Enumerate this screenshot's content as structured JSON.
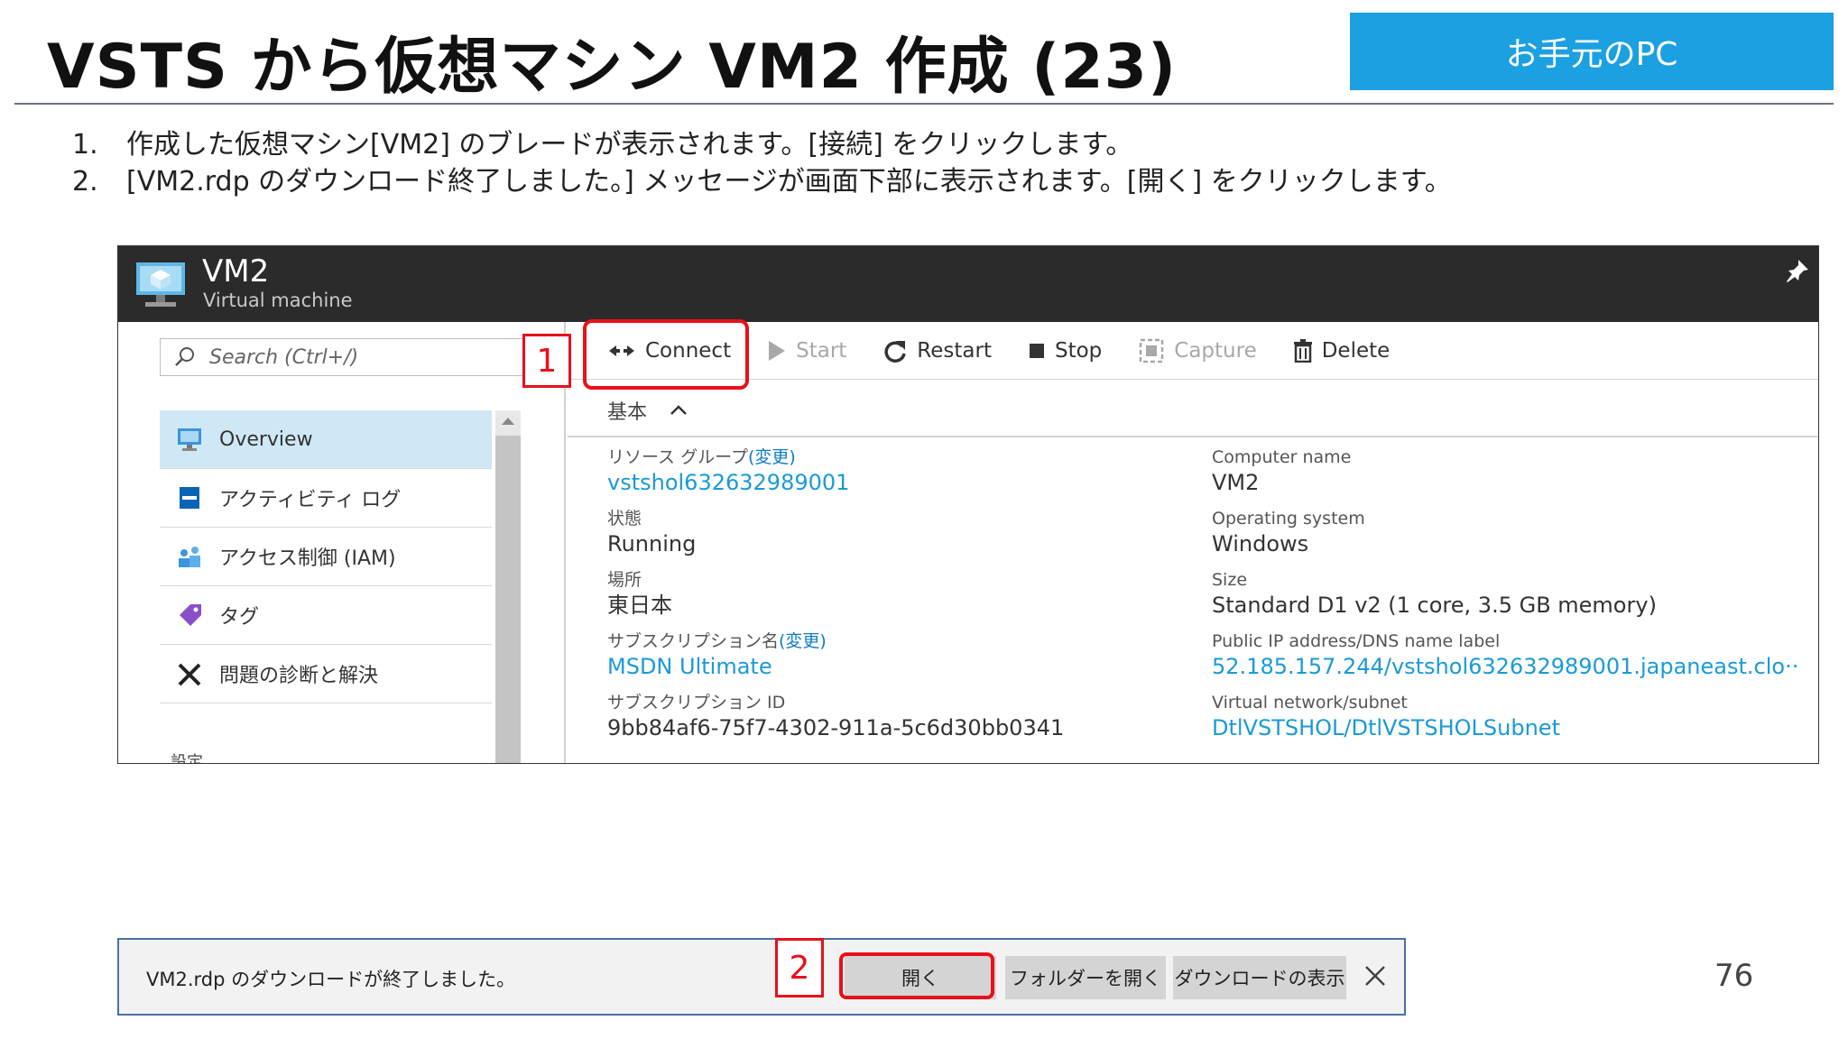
{
  "slide": {
    "title": "VSTS から仮想マシン VM2 作成 (23)",
    "badge": "お手元のPC",
    "steps": [
      {
        "num": "1.",
        "text": "作成した仮想マシン[VM2] のブレードが表示されます。[接続] をクリックします。"
      },
      {
        "num": "2.",
        "text": "[VM2.rdp のダウンロード終了しました。] メッセージが画面下部に表示されます。[開く] をクリックします。"
      }
    ],
    "page_number": "76",
    "callouts": {
      "one": "1",
      "two": "2"
    }
  },
  "blade": {
    "title": "VM2",
    "subtitle": "Virtual machine",
    "search_placeholder": "Search (Ctrl+/)",
    "nav": [
      {
        "label": "Overview",
        "icon": "monitor-icon"
      },
      {
        "label": "アクティビティ ログ",
        "icon": "activity-log-icon"
      },
      {
        "label": "アクセス制御 (IAM)",
        "icon": "users-icon"
      },
      {
        "label": "タグ",
        "icon": "tag-icon"
      },
      {
        "label": "問題の診断と解決",
        "icon": "tools-icon"
      }
    ],
    "section_label": "設定",
    "toolbar": {
      "connect": "Connect",
      "start": "Start",
      "restart": "Restart",
      "stop": "Stop",
      "capture": "Capture",
      "delete": "Delete"
    },
    "essentials": "基本",
    "properties_left": [
      {
        "label": "リソース グループ",
        "change": "(変更)",
        "value": "vstshol632632989001",
        "link": true
      },
      {
        "label": "状態",
        "value": "Running"
      },
      {
        "label": "場所",
        "value": "東日本"
      },
      {
        "label": "サブスクリプション名",
        "change": "(変更)",
        "value": "MSDN Ultimate",
        "link": true
      },
      {
        "label": "サブスクリプション ID",
        "value": "9bb84af6-75f7-4302-911a-5c6d30bb0341"
      }
    ],
    "properties_right": [
      {
        "label": "Computer name",
        "value": "VM2"
      },
      {
        "label": "Operating system",
        "value": "Windows"
      },
      {
        "label": "Size",
        "value": "Standard D1 v2 (1 core, 3.5 GB memory)"
      },
      {
        "label": "Public IP address/DNS name label",
        "value": "52.185.157.244/vstshol632632989001.japaneast.clo··",
        "link": true
      },
      {
        "label": "Virtual network/subnet",
        "value": "DtlVSTSHOL/DtlVSTSHOLSubnet",
        "link": true
      }
    ]
  },
  "download_bar": {
    "message": "VM2.rdp のダウンロードが終了しました。",
    "open": "開く",
    "open_folder": "フォルダーを開く",
    "view_downloads": "ダウンロードの表示"
  },
  "colors": {
    "badge": "#1ba0e1",
    "callout": "#e8101b",
    "link": "#1a9ad6",
    "header": "#2b2b2b",
    "active_nav": "#cfe8f6"
  }
}
